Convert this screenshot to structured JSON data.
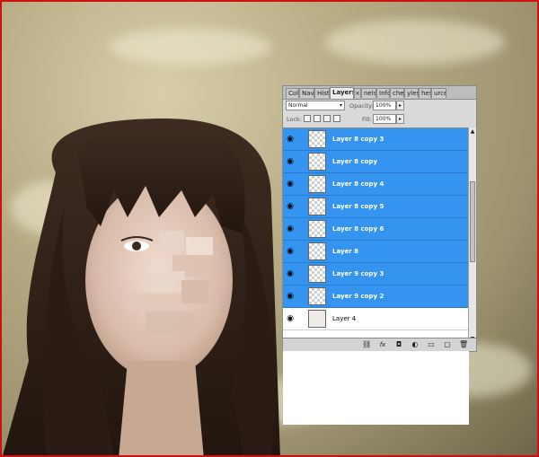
{
  "panel": {
    "tabs": [
      "Col",
      "Nav",
      "Hist",
      "Layers",
      "nels",
      "Info",
      "ches",
      "yles",
      "hes",
      "urce"
    ],
    "active_tab": "Layers",
    "close_glyph": "×",
    "blend_mode": "Normal",
    "opacity_label": "Opacity:",
    "opacity_value": "100%",
    "lock_label": "Lock:",
    "fill_label": "Fill:",
    "fill_value": "100%",
    "stepper_glyph": "▸",
    "dropdown_glyph": "▾"
  },
  "layers": [
    {
      "name": "Layer 8 copy 3",
      "selected": true
    },
    {
      "name": "Layer 8 copy",
      "selected": true
    },
    {
      "name": "Layer 8 copy 4",
      "selected": true
    },
    {
      "name": "Layer 8 copy 5",
      "selected": true
    },
    {
      "name": "Layer 8 copy 6",
      "selected": true
    },
    {
      "name": "Layer 8",
      "selected": true
    },
    {
      "name": "Layer 9 copy 3",
      "selected": true
    },
    {
      "name": "Layer 9 copy 2",
      "selected": true
    },
    {
      "name": "Layer 4",
      "selected": false
    }
  ],
  "bottom_icons": [
    "link-icon",
    "fx-icon",
    "mask-icon",
    "adjustment-icon",
    "group-folder-icon",
    "new-layer-icon",
    "trash-icon"
  ],
  "colors": {
    "selection": "#3494ef",
    "border": "#d01010"
  }
}
